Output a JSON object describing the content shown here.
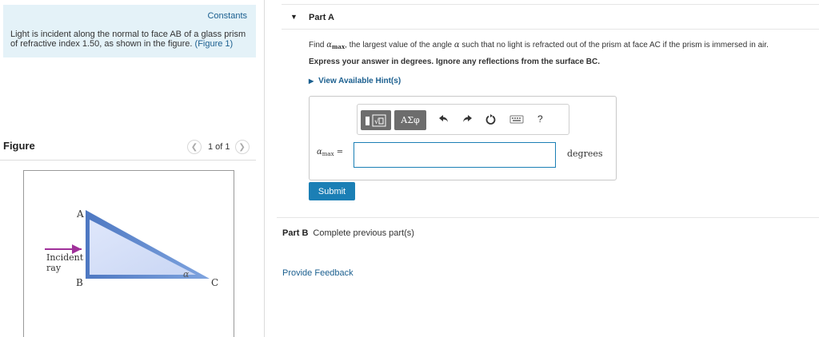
{
  "left": {
    "constants_link": "Constants",
    "problem_text": "Light is incident along the normal to face AB of a glass prism of refractive index 1.50, as shown in the figure.",
    "figure_link": "(Figure 1)",
    "figure_title": "Figure",
    "pager_text": "1 of 1",
    "figure": {
      "label_a": "A",
      "label_b": "B",
      "label_c": "C",
      "label_alpha": "α",
      "label_incident": "Incident",
      "label_ray": "ray"
    }
  },
  "part_a": {
    "title": "Part A",
    "question_prefix": "Find ",
    "alpha_symbol": "α",
    "max_sub": "max",
    "question_suffix": ", the largest value of the angle ",
    "question_end": " such that no light is refracted out of the prism at face AC if the prism is immersed in air.",
    "instruction": "Express your answer in degrees. Ignore any reflections from the surface BC.",
    "hints_label": "View Available Hint(s)",
    "answer_label_eq": " =",
    "answer_value": "",
    "units": "degrees",
    "submit_label": "Submit",
    "toolbar": {
      "greek_label": "ΑΣφ",
      "help_label": "?"
    }
  },
  "part_b": {
    "title": "Part B",
    "text": "Complete previous part(s)"
  },
  "feedback_link": "Provide Feedback",
  "colors": {
    "accent": "#1b7fb5",
    "link": "#1b5f8f",
    "constants_bg": "#e4f2f8",
    "incident_ray": "#a0309a"
  }
}
